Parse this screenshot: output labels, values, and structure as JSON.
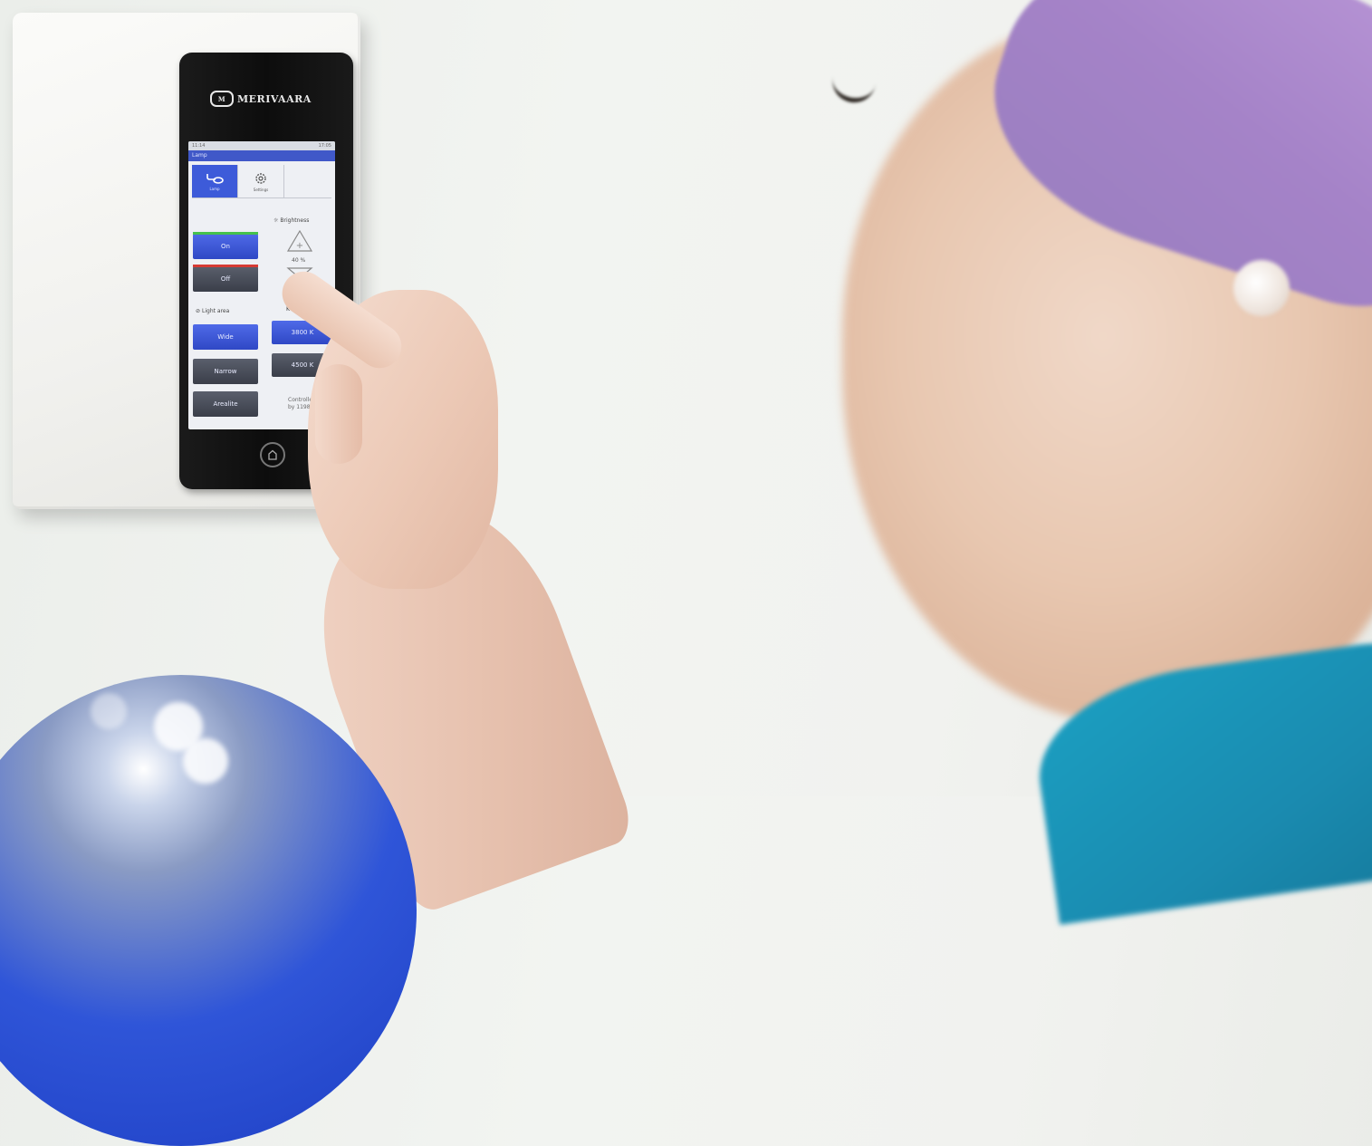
{
  "device": {
    "brand": "MERIVAARA",
    "statusbar": {
      "left": "11:14",
      "right": "17:05"
    },
    "app_title": "Lamp",
    "tabs": [
      {
        "label": "Lamp",
        "icon": "lamp-icon",
        "active": true
      },
      {
        "label": "Settings",
        "icon": "gear-icon",
        "active": false
      }
    ],
    "brightness": {
      "label": "Brightness",
      "value": "40 %"
    },
    "power": {
      "on_label": "On",
      "off_label": "Off"
    },
    "light_area": {
      "label": "Light area",
      "options": [
        "Wide",
        "Narrow",
        "Arealite"
      ]
    },
    "color_temp": {
      "label": "K Color",
      "options": [
        "3800 K",
        "4500 K"
      ]
    },
    "controlled_by": [
      "Controlled",
      "by 1198"
    ]
  },
  "colors": {
    "accent": "#3d5bd9",
    "on_indicator": "#46c24c",
    "off_indicator": "#d63b34"
  }
}
